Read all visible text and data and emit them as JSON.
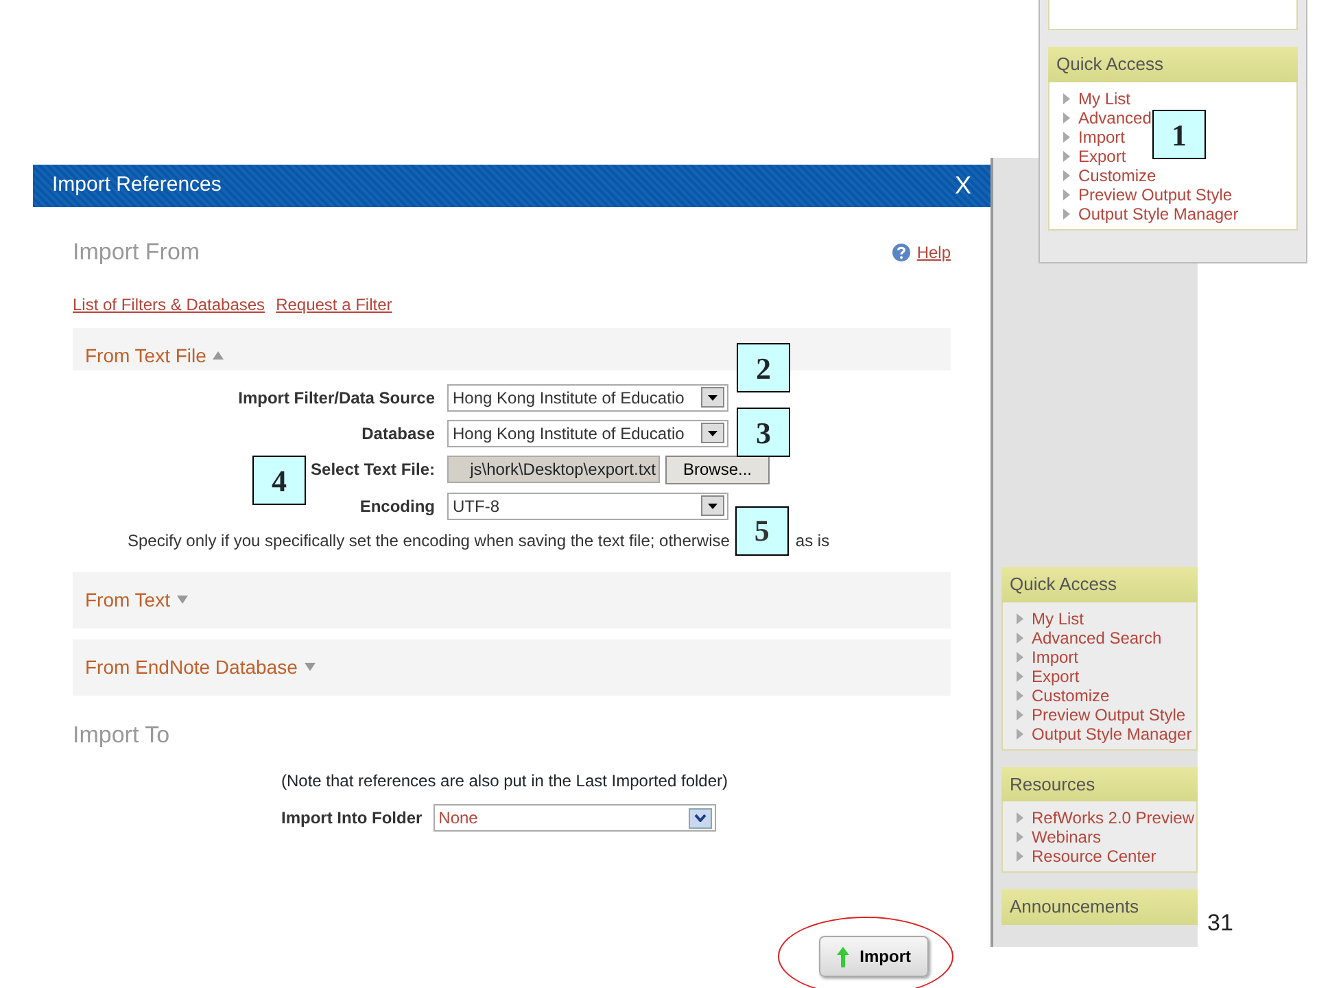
{
  "inset_panel": {
    "title": "Quick Access",
    "items": [
      "My List",
      "Advanced",
      "Import",
      "Export",
      "Customize",
      "Preview Output Style",
      "Output Style Manager"
    ]
  },
  "sidebar": {
    "sections": [
      {
        "title": "Quick Access",
        "items": [
          "My List",
          "Advanced Search",
          "Import",
          "Export",
          "Customize",
          "Preview Output Style",
          "Output Style Manager"
        ]
      },
      {
        "title": "Resources",
        "items": [
          "RefWorks 2.0 Preview",
          "Webinars",
          "Resource Center"
        ]
      },
      {
        "title": "Announcements"
      }
    ]
  },
  "dialog": {
    "title": "Import References",
    "close": "X",
    "heading": "Import From",
    "help": "Help",
    "links": [
      "List of Filters & Databases",
      "Request a Filter"
    ],
    "sections": [
      {
        "title": "From Text File",
        "expanded": true,
        "fields": [
          {
            "kind": "select",
            "label": "Import Filter/Data Source",
            "value": "Hong Kong Institute of Educatio"
          },
          {
            "kind": "select",
            "label": "Database",
            "value": "Hong Kong Institute of Educatio"
          },
          {
            "kind": "file",
            "label": "Select Text File:",
            "value": "js\\hork\\Desktop\\export.txt",
            "button": "Browse..."
          },
          {
            "kind": "select",
            "label": "Encoding",
            "value": "UTF-8"
          }
        ],
        "note_start": "Specify only if you specifically set the encoding when saving the text file; otherwise",
        "note_end": "as is"
      },
      {
        "title": "From Text",
        "expanded": false
      },
      {
        "title": "From EndNote Database",
        "expanded": false
      }
    ],
    "import_to": {
      "heading": "Import To",
      "note": "(Note that references are also put in the Last Imported folder)",
      "label": "Import Into Folder",
      "value": "None"
    },
    "import_button": {
      "label": "Import",
      "circled": true
    }
  },
  "callouts": [
    "1",
    "2",
    "3",
    "4",
    "5"
  ],
  "page_number": "31"
}
